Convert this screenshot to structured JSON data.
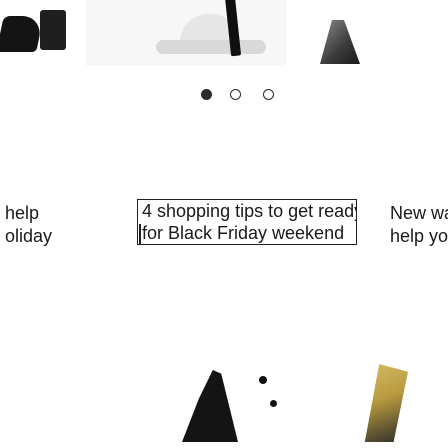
{
  "carousel": {
    "dots": [
      {
        "state": "active"
      },
      {
        "state": "inactive"
      },
      {
        "state": "inactive"
      }
    ],
    "captions": {
      "left": [
        "help",
        "oliday"
      ],
      "center": [
        "4 shopping tips to get ready",
        "for Black Friday weekend"
      ],
      "right": [
        "New wa",
        "help you"
      ]
    }
  },
  "colors": {
    "text": "#1a1a1a",
    "dot": "#2b2b2b",
    "focus_border": "#1f1f1f"
  }
}
